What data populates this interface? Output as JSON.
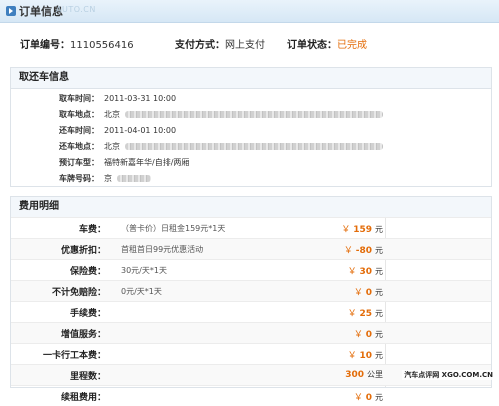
{
  "header": {
    "title": "订单信息",
    "watermark_top": "AUTO.CN"
  },
  "summary": {
    "order_no_label": "订单编号：",
    "order_no": "1110556416",
    "pay_label": "支付方式：",
    "pay_method": "网上支付",
    "status_label": "订单状态：",
    "status": "已完成"
  },
  "pickup": {
    "title": "取还车信息",
    "rows": [
      {
        "label": "取车时间：",
        "value": "2011-03-31 10:00"
      },
      {
        "label": "取车地点：",
        "value": "北京"
      },
      {
        "label": "还车时间：",
        "value": "2011-04-01 10:00"
      },
      {
        "label": "还车地点：",
        "value": "北京"
      },
      {
        "label": "预订车型：",
        "value": "福特新嘉年华/自排/两厢"
      },
      {
        "label": "车牌号码：",
        "value": "京"
      }
    ]
  },
  "fees": {
    "title": "费用明细",
    "currency": "￥",
    "rows": [
      {
        "label": "车费：",
        "desc": "（普卡价）日租金159元*1天",
        "amount": "159",
        "unit": "元"
      },
      {
        "label": "优惠折扣：",
        "desc": "首租首日99元优惠活动",
        "amount": "-80",
        "unit": "元"
      },
      {
        "label": "保险费：",
        "desc": "30元/天*1天",
        "amount": "30",
        "unit": "元"
      },
      {
        "label": "不计免赔险：",
        "desc": "0元/天*1天",
        "amount": "0",
        "unit": "元"
      },
      {
        "label": "手续费：",
        "desc": "",
        "amount": "25",
        "unit": "元"
      },
      {
        "label": "增值服务：",
        "desc": "",
        "amount": "0",
        "unit": "元"
      },
      {
        "label": "一卡行工本费：",
        "desc": "",
        "amount": "10",
        "unit": "元"
      },
      {
        "label": "里程数：",
        "desc": "",
        "amount": "300",
        "unit": "公里"
      },
      {
        "label": "续租费用：",
        "desc": "",
        "amount": "0",
        "unit": "元"
      }
    ]
  },
  "watermark": "汽车点评网 XGO.COM.CN",
  "colors": {
    "accent_orange": "#e36c09",
    "header_blue": "#d6e7f5"
  }
}
